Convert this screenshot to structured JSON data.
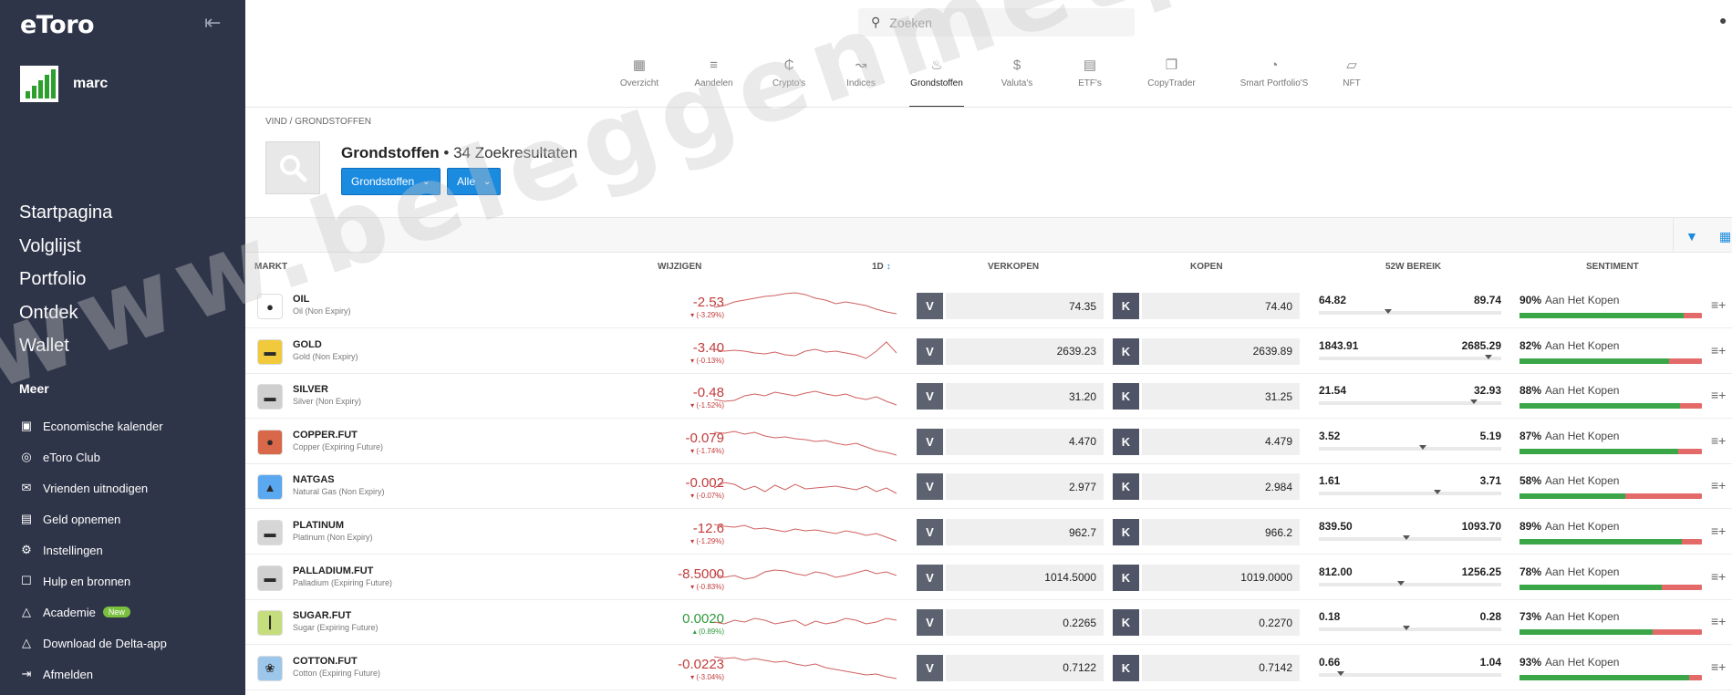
{
  "app": {
    "logo": "eToro"
  },
  "user": {
    "name": "marc"
  },
  "nav": [
    "Startpagina",
    "Volglijst",
    "Portfolio",
    "Ontdek",
    "Wallet"
  ],
  "more": {
    "title": "Meer",
    "items": [
      {
        "label": "Economische kalender",
        "icon": "calendar-icon"
      },
      {
        "label": "eToro Club",
        "icon": "club-icon"
      },
      {
        "label": "Vrienden uitnodigen",
        "icon": "megaphone-icon"
      },
      {
        "label": "Geld opnemen",
        "icon": "wallet-icon"
      },
      {
        "label": "Instellingen",
        "icon": "gear-icon"
      },
      {
        "label": "Hulp en bronnen",
        "icon": "help-icon"
      },
      {
        "label": "Academie",
        "icon": "academy-icon",
        "badge": "New"
      },
      {
        "label": "Download de Delta-app",
        "icon": "delta-icon"
      },
      {
        "label": "Afmelden",
        "icon": "logout-icon"
      }
    ]
  },
  "search": {
    "placeholder": "Zoeken"
  },
  "tabs": [
    {
      "label": "Overzicht",
      "icon": "grid-icon"
    },
    {
      "label": "Aandelen",
      "icon": "stocks-icon"
    },
    {
      "label": "Crypto's",
      "icon": "crypto-icon"
    },
    {
      "label": "Indices",
      "icon": "indices-icon"
    },
    {
      "label": "Grondstoffen",
      "icon": "commodities-icon",
      "active": true
    },
    {
      "label": "Valuta's",
      "icon": "currency-icon"
    },
    {
      "label": "ETF's",
      "icon": "etf-icon"
    },
    {
      "label": "CopyTrader",
      "icon": "copytrader-icon"
    },
    {
      "label": "Smart Portfolio'S",
      "icon": "smart-portfolio-icon"
    },
    {
      "label": "NFT",
      "icon": "nft-icon"
    }
  ],
  "breadcrumb": "VIND / GRONDSTOFFEN",
  "page": {
    "title": "Grondstoffen",
    "results": "• 34 Zoekresultaten"
  },
  "filters": {
    "category": "Grondstoffen",
    "all": "Alle"
  },
  "columns": {
    "market": "MARKT",
    "change": "WIJZIGEN",
    "period": "1D",
    "sell": "VERKOPEN",
    "buy": "KOPEN",
    "range": "52W BEREIK",
    "sentiment": "SENTIMENT"
  },
  "labels": {
    "sell_btn": "V",
    "buy_btn": "K",
    "sentiment_text": "Aan Het Kopen"
  },
  "rows": [
    {
      "symbol": "OIL",
      "name": "Oil (Non Expiry)",
      "change": "-2.53",
      "change_pct": "(-3.29%)",
      "sell": "74.35",
      "buy": "74.40",
      "low": "64.82",
      "high": "89.74",
      "range_pos": 0.38,
      "sentiment": "90%",
      "sentiment_val": 0.9,
      "logo_bg": "#ffffff",
      "logo_glyph": "●"
    },
    {
      "symbol": "GOLD",
      "name": "Gold (Non Expiry)",
      "change": "-3.40",
      "change_pct": "(-0.13%)",
      "sell": "2639.23",
      "buy": "2639.89",
      "low": "1843.91",
      "high": "2685.29",
      "range_pos": 0.93,
      "sentiment": "82%",
      "sentiment_val": 0.82,
      "logo_bg": "#f0c93c",
      "logo_glyph": "▬"
    },
    {
      "symbol": "SILVER",
      "name": "Silver (Non Expiry)",
      "change": "-0.48",
      "change_pct": "(-1.52%)",
      "sell": "31.20",
      "buy": "31.25",
      "low": "21.54",
      "high": "32.93",
      "range_pos": 0.85,
      "sentiment": "88%",
      "sentiment_val": 0.88,
      "logo_bg": "#cfcfcf",
      "logo_glyph": "▬"
    },
    {
      "symbol": "COPPER.FUT",
      "name": "Copper (Expiring Future)",
      "change": "-0.079",
      "change_pct": "(-1.74%)",
      "sell": "4.470",
      "buy": "4.479",
      "low": "3.52",
      "high": "5.19",
      "range_pos": 0.57,
      "sentiment": "87%",
      "sentiment_val": 0.87,
      "logo_bg": "#d9674a",
      "logo_glyph": "●"
    },
    {
      "symbol": "NATGAS",
      "name": "Natural Gas (Non Expiry)",
      "change": "-0.002",
      "change_pct": "(-0.07%)",
      "sell": "2.977",
      "buy": "2.984",
      "low": "1.61",
      "high": "3.71",
      "range_pos": 0.65,
      "sentiment": "58%",
      "sentiment_val": 0.58,
      "logo_bg": "#5aa8f0",
      "logo_glyph": "▲"
    },
    {
      "symbol": "PLATINUM",
      "name": "Platinum (Non Expiry)",
      "change": "-12.6",
      "change_pct": "(-1.29%)",
      "sell": "962.7",
      "buy": "966.2",
      "low": "839.50",
      "high": "1093.70",
      "range_pos": 0.48,
      "sentiment": "89%",
      "sentiment_val": 0.89,
      "logo_bg": "#d6d6d6",
      "logo_glyph": "▬"
    },
    {
      "symbol": "PALLADIUM.FUT",
      "name": "Palladium (Expiring Future)",
      "change": "-8.5000",
      "change_pct": "(-0.83%)",
      "sell": "1014.5000",
      "buy": "1019.0000",
      "low": "812.00",
      "high": "1256.25",
      "range_pos": 0.45,
      "sentiment": "78%",
      "sentiment_val": 0.78,
      "logo_bg": "#d0d0d0",
      "logo_glyph": "▬"
    },
    {
      "symbol": "SUGAR.FUT",
      "name": "Sugar (Expiring Future)",
      "change": "0.0020",
      "change_pct": "(0.89%)",
      "positive": true,
      "sell": "0.2265",
      "buy": "0.2270",
      "low": "0.18",
      "high": "0.28",
      "range_pos": 0.48,
      "sentiment": "73%",
      "sentiment_val": 0.73,
      "logo_bg": "#c5dd7c",
      "logo_glyph": "┃"
    },
    {
      "symbol": "COTTON.FUT",
      "name": "Cotton (Expiring Future)",
      "change": "-0.0223",
      "change_pct": "(-3.04%)",
      "sell": "0.7122",
      "buy": "0.7142",
      "low": "0.66",
      "high": "1.04",
      "range_pos": 0.12,
      "sentiment": "93%",
      "sentiment_val": 0.93,
      "logo_bg": "#9cc6ea",
      "logo_glyph": "❀"
    }
  ],
  "watermark": "www.beleggenmetpassie.nl"
}
